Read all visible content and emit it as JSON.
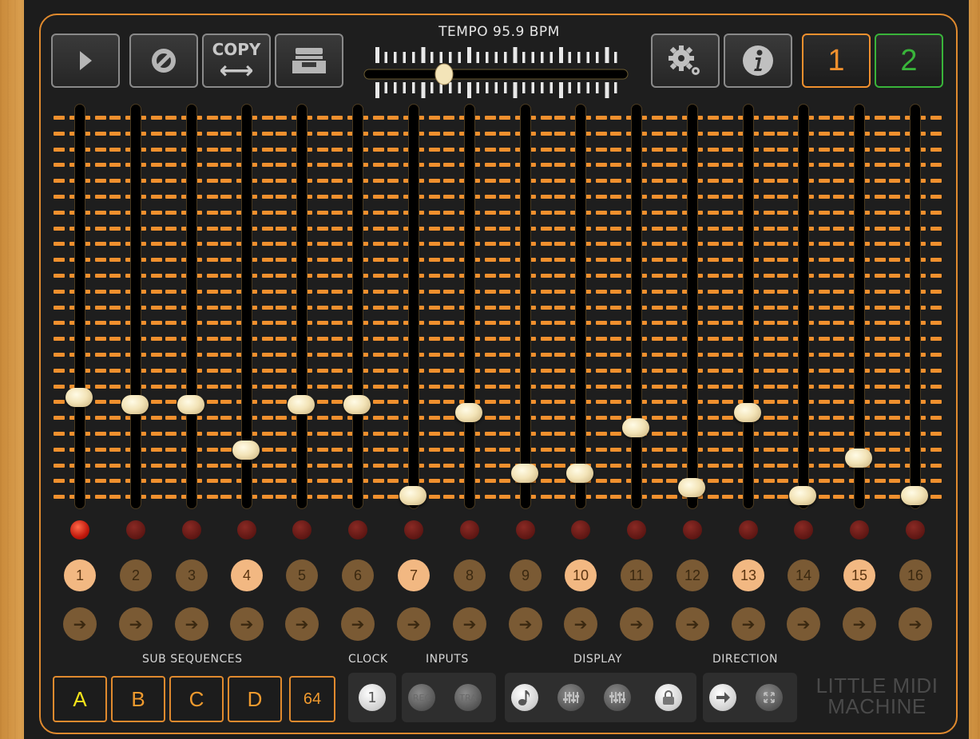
{
  "toolbar": {
    "play": "play-icon",
    "clear": "clear-icon",
    "copy_label": "COPY",
    "copy_arrow": "⟷",
    "archive": "tray-icon",
    "settings": "gear-icon",
    "info": "info-icon"
  },
  "tempo": {
    "label": "TEMPO 95.9 BPM",
    "value": 95.9
  },
  "patterns": [
    {
      "label": "1",
      "color": "#f0902e"
    },
    {
      "label": "2",
      "color": "#39b43a"
    }
  ],
  "steps": [
    {
      "number": "1",
      "level": 0.515,
      "active_led": true,
      "enabled": true
    },
    {
      "number": "2",
      "level": 0.475,
      "active_led": false,
      "enabled": false
    },
    {
      "number": "3",
      "level": 0.475,
      "active_led": false,
      "enabled": false
    },
    {
      "number": "4",
      "level": 0.237,
      "active_led": false,
      "enabled": true
    },
    {
      "number": "5",
      "level": 0.475,
      "active_led": false,
      "enabled": false
    },
    {
      "number": "6",
      "level": 0.475,
      "active_led": false,
      "enabled": false
    },
    {
      "number": "7",
      "level": 0.0,
      "active_led": false,
      "enabled": true
    },
    {
      "number": "8",
      "level": 0.436,
      "active_led": false,
      "enabled": false
    },
    {
      "number": "9",
      "level": 0.119,
      "active_led": false,
      "enabled": false
    },
    {
      "number": "10",
      "level": 0.119,
      "active_led": false,
      "enabled": true
    },
    {
      "number": "11",
      "level": 0.356,
      "active_led": false,
      "enabled": false
    },
    {
      "number": "12",
      "level": 0.04,
      "active_led": false,
      "enabled": false
    },
    {
      "number": "13",
      "level": 0.436,
      "active_led": false,
      "enabled": true
    },
    {
      "number": "14",
      "level": 0.0,
      "active_led": false,
      "enabled": false
    },
    {
      "number": "15",
      "level": 0.198,
      "active_led": false,
      "enabled": true
    },
    {
      "number": "16",
      "level": 0.0,
      "active_led": false,
      "enabled": false
    }
  ],
  "step_arrow": "➔",
  "sub_sequences": {
    "label": "SUB SEQUENCES",
    "buttons": [
      {
        "label": "A",
        "color": "#f4e31a"
      },
      {
        "label": "B",
        "color": "#f09a2e"
      },
      {
        "label": "C",
        "color": "#f09a2e"
      },
      {
        "label": "D",
        "color": "#f09a2e"
      }
    ],
    "length": "64"
  },
  "clock": {
    "label": "CLOCK",
    "value": "1"
  },
  "inputs": {
    "label": "INPUTS",
    "rec": "REC",
    "tra": "TRA"
  },
  "display": {
    "label": "DISPLAY"
  },
  "direction": {
    "label": "DIRECTION"
  },
  "logo": {
    "line1": "LITTLE MIDI",
    "line2": "MACHINE"
  },
  "colors": {
    "accent": "#e08a2e",
    "panel": "#1e1e1e",
    "led_on": "#d01a0c"
  }
}
